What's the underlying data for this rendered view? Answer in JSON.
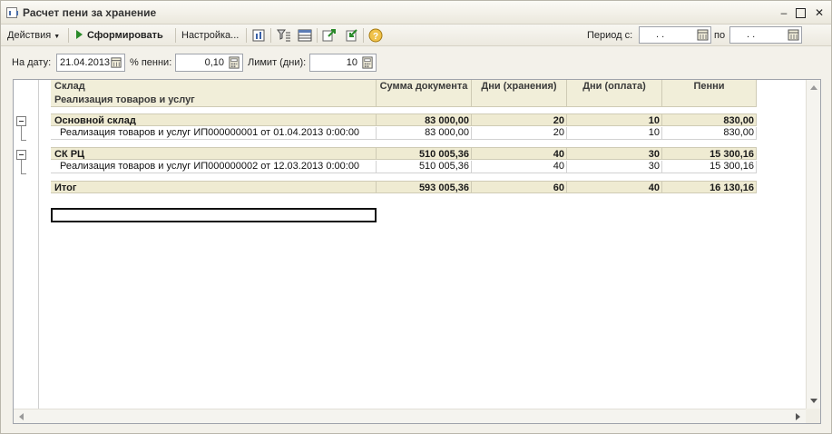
{
  "window": {
    "title": "Расчет пени за хранение"
  },
  "toolbar": {
    "actions_label": "Действия",
    "generate_label": "Сформировать",
    "settings_label": "Настройка...",
    "period_from_label": "Период с:",
    "period_from_value": ". .",
    "period_to_label": "по",
    "period_to_value": ". ."
  },
  "params": {
    "date_label": "На дату:",
    "date_value": "21.04.2013",
    "penalty_label": "% пенни:",
    "penalty_value": "0,10",
    "limit_label": "Лимит (дни):",
    "limit_value": "10"
  },
  "report": {
    "headers": {
      "warehouse": "Склад",
      "document": "Реализация товаров и услуг",
      "amount": "Сумма документа",
      "days_storage": "Дни (хранения)",
      "days_payment": "Дни (оплата)",
      "penalty": "Пенни"
    },
    "groups": [
      {
        "name": "Основной склад",
        "amount": "83 000,00",
        "days_storage": "20",
        "days_payment": "10",
        "penalty": "830,00",
        "rows": [
          {
            "document": "Реализация товаров и услуг ИП000000001 от 01.04.2013 0:00:00",
            "amount": "83 000,00",
            "days_storage": "20",
            "days_payment": "10",
            "penalty": "830,00"
          }
        ]
      },
      {
        "name": "СК РЦ",
        "amount": "510 005,36",
        "days_storage": "40",
        "days_payment": "30",
        "penalty": "15 300,16",
        "rows": [
          {
            "document": "Реализация товаров и услуг ИП000000002 от 12.03.2013 0:00:00",
            "amount": "510 005,36",
            "days_storage": "40",
            "days_payment": "30",
            "penalty": "15 300,16"
          }
        ]
      }
    ],
    "total": {
      "label": "Итог",
      "amount": "593 005,36",
      "days_storage": "60",
      "days_payment": "40",
      "penalty": "16 130,16"
    }
  },
  "colors": {
    "header_bg": "#f1eed9",
    "group_bg": "#efebd2",
    "accent_green": "#2a8a2a"
  },
  "icons": [
    "report-icon",
    "minimize-icon",
    "maximize-icon",
    "close-icon",
    "play-icon",
    "report-settings-icon",
    "filter-icon",
    "table-icon",
    "export-icon",
    "import-icon",
    "help-icon",
    "calendar-icon",
    "collapse-icon"
  ]
}
